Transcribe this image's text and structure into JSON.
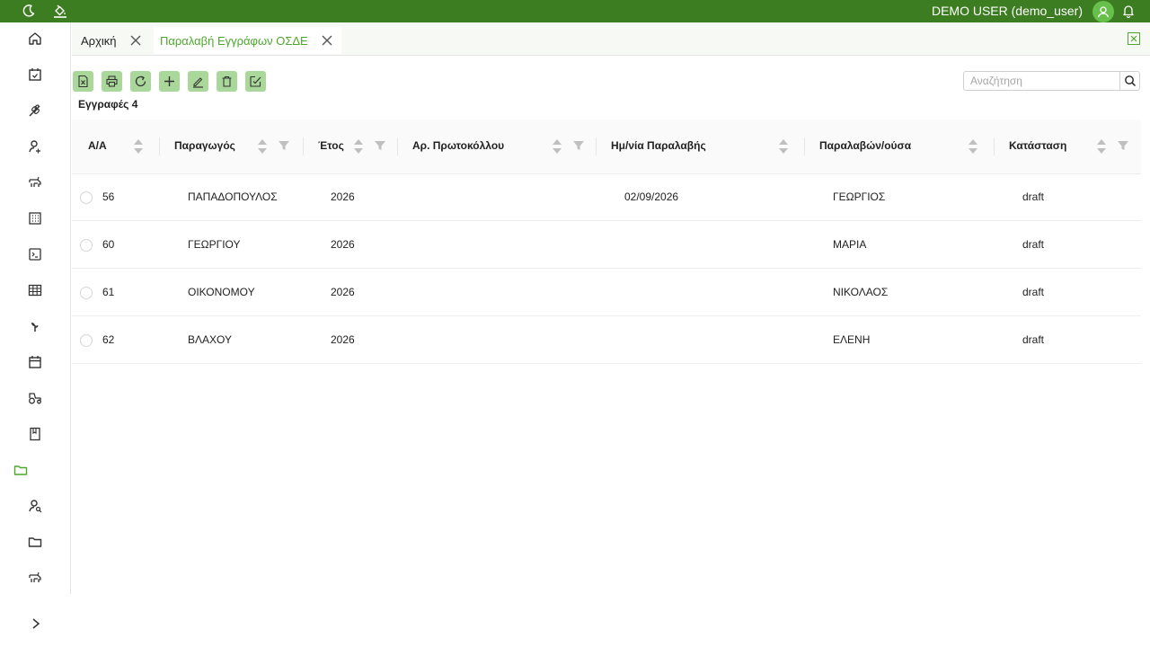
{
  "topbar": {
    "user_label": "DEMO USER (demo_user)",
    "icons": [
      "moon-icon",
      "paint-bucket-icon",
      "user-avatar-icon",
      "bell-icon"
    ]
  },
  "sidebar": {
    "items": [
      "home-icon",
      "calendar-check-icon",
      "wheat-icon",
      "user-icon",
      "animal-icon",
      "building-icon",
      "terminal-icon",
      "table-icon",
      "plant-icon",
      "calendar-icon",
      "tractor-icon",
      "book-icon",
      "folder-icon",
      "user-search-icon",
      "folder-icon",
      "animal-icon"
    ],
    "active_index": 12,
    "expand_icon": "chevron-right-icon"
  },
  "tabs": [
    {
      "label": "Αρχική",
      "active": false
    },
    {
      "label": "Παραλαβή Εγγράφων ΟΣΔΕ",
      "active": true
    }
  ],
  "toolbar": {
    "buttons": [
      "excel-export-icon",
      "print-icon",
      "refresh-icon",
      "add-icon",
      "edit-icon",
      "delete-icon",
      "checkbox-edit-icon"
    ]
  },
  "search": {
    "placeholder": "Αναζήτηση",
    "value": ""
  },
  "records": {
    "label": "Εγγραφές 4"
  },
  "table": {
    "columns": [
      "Α/Α",
      "Παραγωγός",
      "Έτος",
      "Αρ. Πρωτοκόλλου",
      "Ημ/νία Παραλαβής",
      "Παραλαβών/ούσα",
      "Κατάσταση"
    ],
    "rows": [
      [
        "56",
        "ΠΑΠΑΔΟΠΟΥΛΟΣ",
        "2026",
        "",
        "02/09/2026",
        "ΓΕΩΡΓΙΟΣ",
        "draft"
      ],
      [
        "60",
        "ΓΕΩΡΓΙΟΥ",
        "2026",
        "",
        "",
        "ΜΑΡΙΑ",
        "draft"
      ],
      [
        "61",
        "ΟΙΚΟΝΟΜΟΥ",
        "2026",
        "",
        "",
        "ΝΙΚΟΛΑΟΣ",
        "draft"
      ],
      [
        "62",
        "ΒΛΑΧΟΥ",
        "2026",
        "",
        "",
        "ΕΛΕΝΗ",
        "draft"
      ]
    ]
  },
  "colors": {
    "brand": "#3c7d22",
    "accent": "#4ca82d",
    "button_bg": "#a9d89a"
  }
}
